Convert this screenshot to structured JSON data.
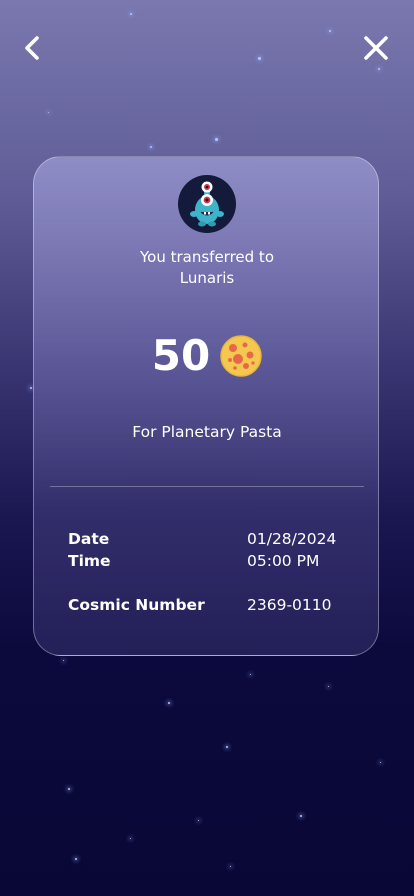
{
  "transfer": {
    "heading_line1": "You transferred to",
    "heading_line2": "Lunaris",
    "amount": "50",
    "currency_icon": "cheese-moon-coin-icon",
    "purpose": "For Planetary Pasta"
  },
  "details": {
    "date_label": "Date",
    "date_value": "01/28/2024",
    "time_label": "Time",
    "time_value": "05:00 PM",
    "cosmic_label": "Cosmic Number",
    "cosmic_value": "2369-0110"
  },
  "icons": {
    "back": "chevron-left-icon",
    "close": "close-icon",
    "avatar": "alien-monster-avatar"
  },
  "colors": {
    "background_top": "#7a78ae",
    "background_bottom": "#090735",
    "coin": "#f4c84e",
    "coin_spots": "#e8674a",
    "avatar_bg": "#141a3a",
    "alien": "#3fb3c9"
  }
}
